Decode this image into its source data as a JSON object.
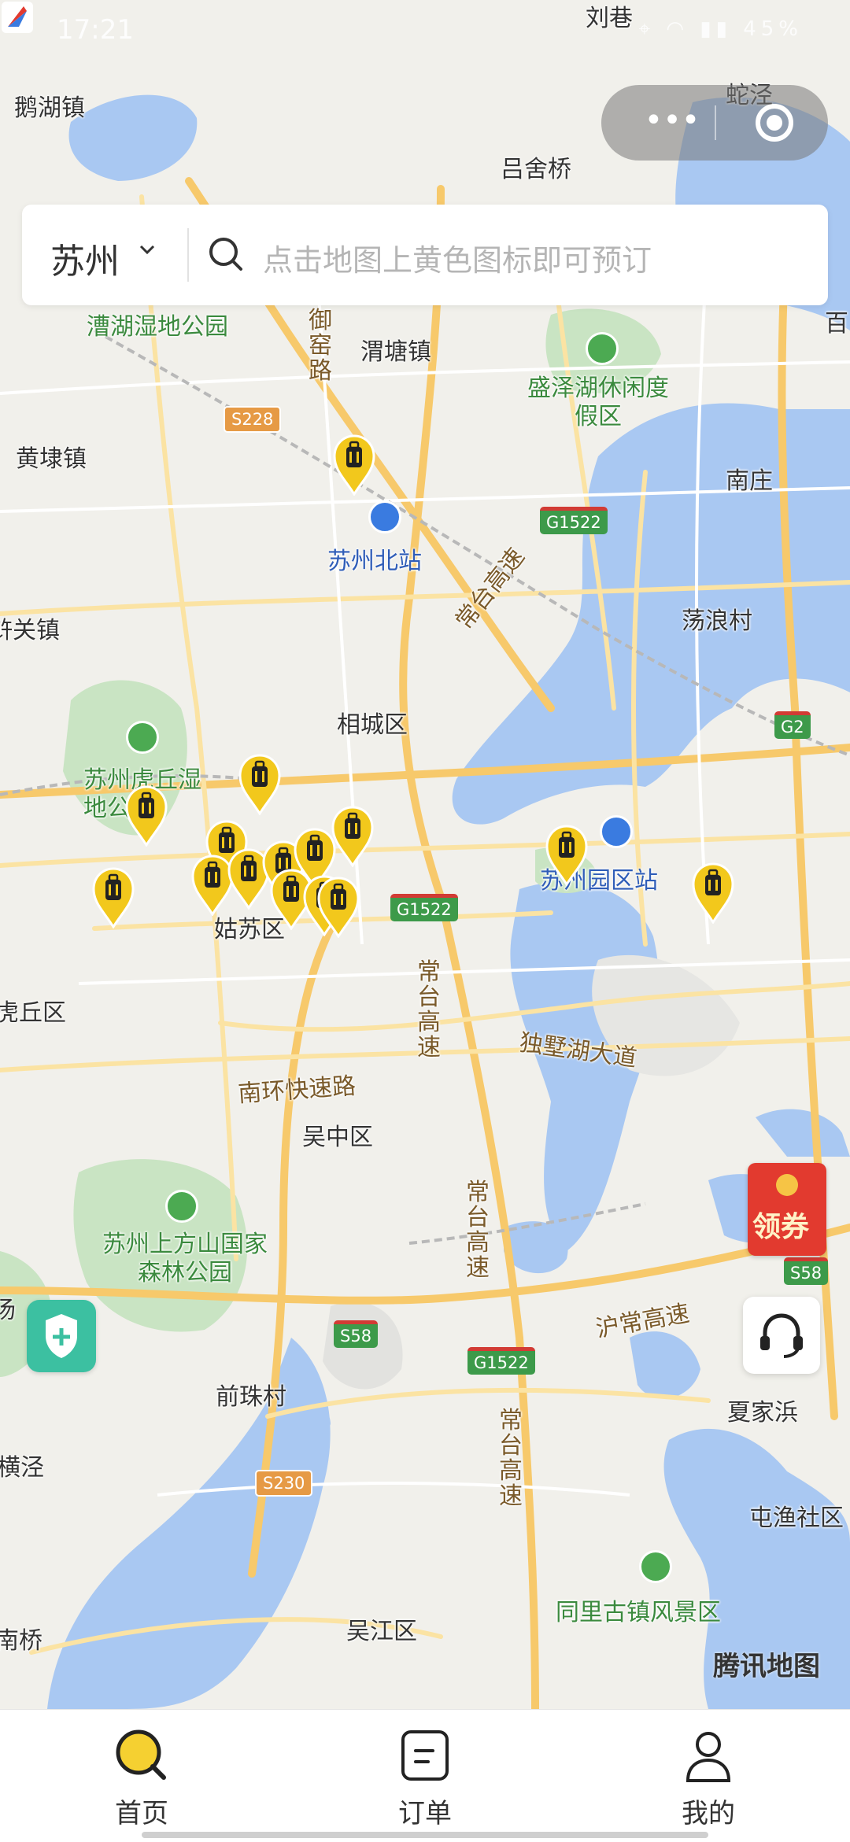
{
  "status_bar": {
    "time": "17:21",
    "battery": "45%"
  },
  "capsule": {
    "more_label": "•••"
  },
  "search": {
    "city": "苏州",
    "placeholder": "点击地图上黄色图标即可预订"
  },
  "map": {
    "places": [
      {
        "name": "鹅湖镇"
      },
      {
        "name": "刘巷"
      },
      {
        "name": "蛇泾"
      },
      {
        "name": "吕舍桥"
      },
      {
        "name": "漕湖湿地公园"
      },
      {
        "name": "御窑路"
      },
      {
        "name": "渭塘镇"
      },
      {
        "name": "盛泽湖休闲度假区"
      },
      {
        "name": "百"
      },
      {
        "name": "黄埭镇"
      },
      {
        "name": "南庄"
      },
      {
        "name": "苏州北站"
      },
      {
        "name": "荡浪村"
      },
      {
        "name": "浒关镇"
      },
      {
        "name": "常台高速"
      },
      {
        "name": "相城区"
      },
      {
        "name": "苏州虎丘湿地公园"
      },
      {
        "name": "苏州园区站"
      },
      {
        "name": "姑苏区"
      },
      {
        "name": "虎丘区"
      },
      {
        "name": "南环快速路"
      },
      {
        "name": "独墅湖大道"
      },
      {
        "name": "吴中区"
      },
      {
        "name": "苏州上方山国家森林公园"
      },
      {
        "name": "沪常高速"
      },
      {
        "name": "前珠村"
      },
      {
        "name": "夏家浜"
      },
      {
        "name": "横泾"
      },
      {
        "name": "屯渔社区"
      },
      {
        "name": "同里古镇风景区"
      },
      {
        "name": "吴江区"
      },
      {
        "name": "南桥"
      },
      {
        "name": "汤"
      }
    ],
    "road_shields": [
      "S228",
      "G1522",
      "G2",
      "G1522",
      "S58",
      "S58",
      "G1522",
      "S230"
    ],
    "attribution": "腾讯地图",
    "pin_icon": "luggage-icon",
    "pin_color": "#f2c81c"
  },
  "floating": {
    "coupon_label": "领券"
  },
  "tabbar": {
    "items": [
      {
        "label": "首页",
        "icon": "search-icon"
      },
      {
        "label": "订单",
        "icon": "order-icon"
      },
      {
        "label": "我的",
        "icon": "user-icon"
      }
    ],
    "active": 0,
    "accent": "#f5d031"
  }
}
